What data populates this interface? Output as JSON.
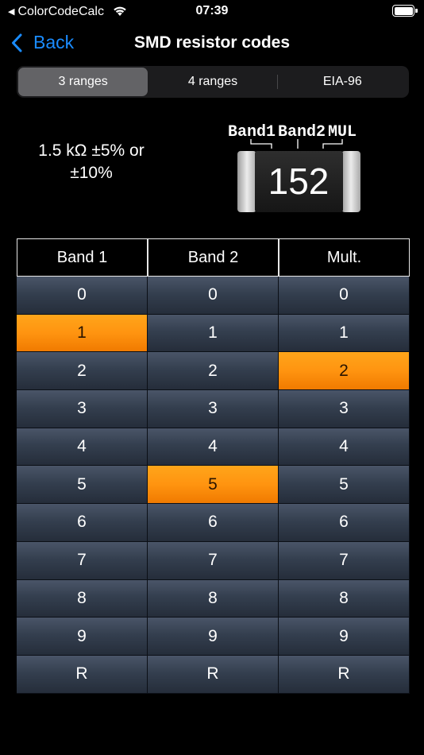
{
  "status_bar": {
    "back_app": "ColorCodeCalc",
    "time": "07:39"
  },
  "nav": {
    "back_label": "Back",
    "title": "SMD resistor codes"
  },
  "segments": [
    {
      "label": "3 ranges",
      "selected": true
    },
    {
      "label": "4 ranges",
      "selected": false
    },
    {
      "label": "EIA-96",
      "selected": false
    }
  ],
  "result": {
    "value": "1.5 kΩ ±5% or ±10%"
  },
  "diagram": {
    "band1_label": "Band1",
    "band2_label": "Band2",
    "mul_label": "MUL",
    "code": "152"
  },
  "table": {
    "headers": [
      "Band 1",
      "Band 2",
      "Mult."
    ],
    "values": [
      "0",
      "1",
      "2",
      "3",
      "4",
      "5",
      "6",
      "7",
      "8",
      "9",
      "R"
    ],
    "selected": [
      "1",
      "5",
      "2"
    ]
  },
  "colors": {
    "accent": "#1a8cff",
    "selected_cell": "#ff9410",
    "cell": "#343f4f",
    "background": "#000000"
  }
}
